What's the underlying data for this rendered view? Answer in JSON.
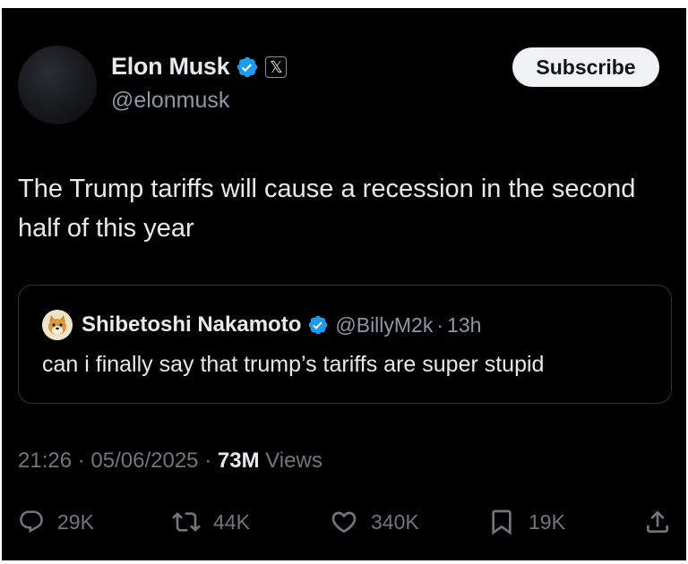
{
  "tweet": {
    "author_name": "Elon Musk",
    "author_handle": "@elonmusk",
    "affiliate_badge": "𝕏",
    "subscribe_label": "Subscribe",
    "text": "The Trump tariffs will cause a recession in the second half of this year",
    "time": "21:26",
    "date": "05/06/2025",
    "views_count": "73M",
    "views_label": "Views"
  },
  "quote": {
    "author_name": "Shibetoshi Nakamoto",
    "author_handle": "@BillyM2k",
    "age": "13h",
    "text": "can i finally say that trump’s tariffs are super stupid"
  },
  "actions": {
    "replies": "29K",
    "reposts": "44K",
    "likes": "340K",
    "bookmarks": "19K"
  },
  "colors": {
    "background": "#000000",
    "verified": "#1d9bf0",
    "text_primary": "#e7e9ea",
    "text_secondary": "#71767b"
  },
  "icons": [
    "verified-icon",
    "x-affiliate-icon",
    "reply-icon",
    "repost-icon",
    "like-icon",
    "bookmark-icon",
    "share-icon"
  ]
}
